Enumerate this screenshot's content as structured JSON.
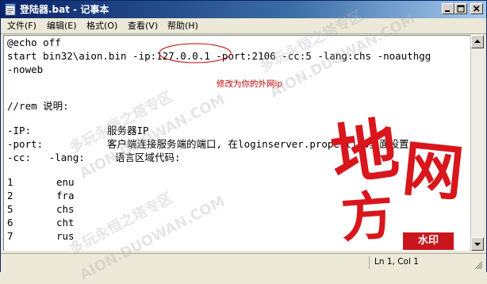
{
  "window": {
    "title": "登陆器.bat - 记事本",
    "icon": "notepad-icon"
  },
  "titlebar_buttons": {
    "minimize_icon": "minimize-icon",
    "maximize_icon": "maximize-icon",
    "close_icon": "close-icon"
  },
  "menu": {
    "items": [
      {
        "label": "文件(F)"
      },
      {
        "label": "编辑(E)"
      },
      {
        "label": "格式(O)"
      },
      {
        "label": "查看(V)"
      },
      {
        "label": "帮助(H)"
      }
    ]
  },
  "editor": {
    "lines": [
      "@echo off",
      "start bin32\\aion.bin -ip:127.0.0.1 -port:2106 -cc:5 -lang:chs -noauthgg",
      "-noweb",
      "//rem 说明:",
      "-IP:",
      "-port:",
      "-cc:   -lang:"
    ],
    "desc": {
      "ip": "服务器IP",
      "port": "客户端连接服务端的端口, 在loginserver.properties里面设置",
      "lang": "语言区域代码:"
    },
    "codes": [
      {
        "num": "1",
        "code": "enu"
      },
      {
        "num": "2",
        "code": "fra"
      },
      {
        "num": "5",
        "code": "chs"
      },
      {
        "num": "6",
        "code": "cht"
      },
      {
        "num": "7",
        "code": "rus"
      }
    ],
    "annotation": "修改为你的外网ip",
    "annotation_color": "#c00000"
  },
  "statusbar": {
    "position": "Ln 1, Col 1"
  },
  "watermark": {
    "big_chars": [
      "地",
      "网",
      "方"
    ],
    "badge": "水印",
    "diag_text": [
      "多玩永恒之塔专区",
      "AION.DUOWAN.COM",
      "多玩永恒之塔专区",
      "AION.DUOWAN.COM",
      "多玩永恒之塔专区",
      "AION.DUOWAN.COM"
    ],
    "color": "#d8161c"
  }
}
